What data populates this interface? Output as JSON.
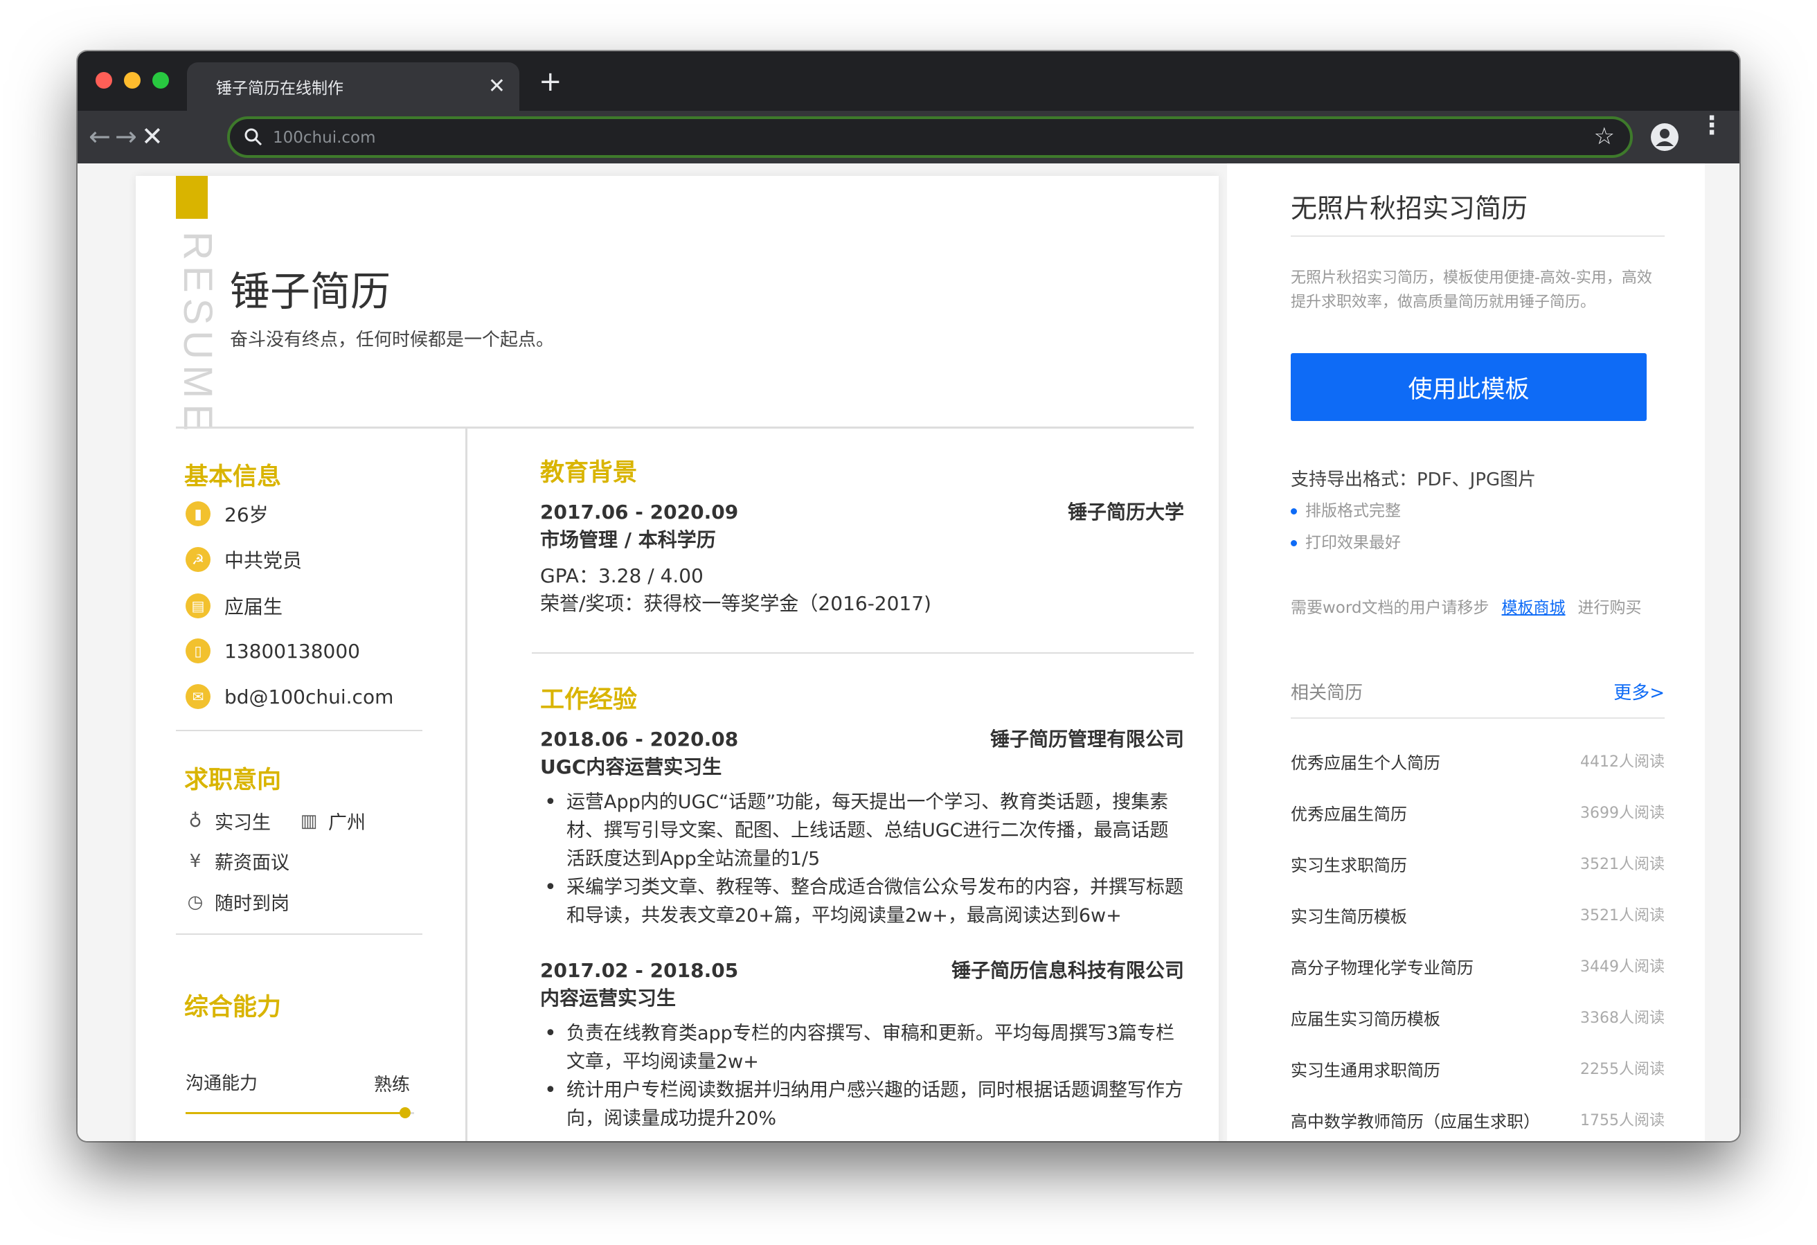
{
  "browser": {
    "tab_title": "锤子简历在线制作",
    "tab_close": "✕",
    "new_tab": "+",
    "url": "100chui.com",
    "colors": {
      "red": "#ff5f57",
      "yellow": "#febc2e",
      "green": "#28c840"
    }
  },
  "resume": {
    "vertical_label": "RESUME",
    "name": "锤子简历",
    "motto": "奋斗没有终点，任何时候都是一个起点。",
    "basic": {
      "title": "基本信息",
      "items": [
        {
          "icon": "chart-icon",
          "text": "26岁"
        },
        {
          "icon": "party-icon",
          "text": "中共党员"
        },
        {
          "icon": "calendar-icon",
          "text": "应届生"
        },
        {
          "icon": "phone-icon",
          "text": "13800138000"
        },
        {
          "icon": "mail-icon",
          "text": "bd@100chui.com"
        }
      ]
    },
    "intent": {
      "title": "求职意向",
      "job": "实习生",
      "city": "广州",
      "salary": "薪资面议",
      "start": "随时到岗"
    },
    "skills": {
      "title": "综合能力",
      "items": [
        {
          "name": "沟通能力",
          "level": "熟练",
          "fraction": 0.96
        }
      ]
    },
    "education": {
      "title": "教育背景",
      "period": "2017.06 - 2020.09",
      "school": "锤子简历大学",
      "major": "市场管理 / 本科学历",
      "gpa": "GPA：3.28 / 4.00",
      "honor": "荣誉/奖项：获得校一等奖学金（2016-2017)"
    },
    "work": {
      "title": "工作经验",
      "jobs": [
        {
          "period": "2018.06 - 2020.08",
          "company": "锤子简历管理有限公司",
          "role": "UGC内容运营实习生",
          "bullets": [
            "运营App内的UGC“话题”功能，每天提出一个学习、教育类话题，搜集素材、撰写引导文案、配图、上线话题、总结UGC进行二次传播，最高话题活跃度达到App全站流量的1/5",
            "采编学习类文章、教程等、整合成适合微信公众号发布的内容，并撰写标题和导读，共发表文章20+篇，平均阅读量2w+，最高阅读达到6w+"
          ]
        },
        {
          "period": "2017.02 - 2018.05",
          "company": "锤子简历信息科技有限公司",
          "role": "内容运营实习生",
          "bullets": [
            "负责在线教育类app专栏的内容撰写、审稿和更新。平均每周撰写3篇专栏文章，平均阅读量2w+",
            "统计用户专栏阅读数据并归纳用户感兴趣的话题，同时根据话题调整写作方向，阅读量成功提升20%"
          ]
        }
      ]
    }
  },
  "sidebar": {
    "title": "无照片秋招实习简历",
    "description": "无照片秋招实习简历，模板使用便捷-高效-实用，高效提升求职效率，做高质量简历就用锤子简历。",
    "use_button": "使用此模板",
    "formats": "支持导出格式：PDF、JPG图片",
    "features": [
      "排版格式完整",
      "打印效果最好"
    ],
    "word_prefix": "需要word文档的用户请移步",
    "word_link": "模板商城",
    "word_suffix": "进行购买",
    "related_title": "相关简历",
    "more": "更多>",
    "related": [
      {
        "name": "优秀应届生个人简历",
        "reads": "4412人阅读"
      },
      {
        "name": "优秀应届生简历",
        "reads": "3699人阅读"
      },
      {
        "name": "实习生求职简历",
        "reads": "3521人阅读"
      },
      {
        "name": "实习生简历模板",
        "reads": "3521人阅读"
      },
      {
        "name": "高分子物理化学专业简历",
        "reads": "3449人阅读"
      },
      {
        "name": "应届生实习简历模板",
        "reads": "3368人阅读"
      },
      {
        "name": "实习生通用求职简历",
        "reads": "2255人阅读"
      },
      {
        "name": "高中数学教师简历（应届生求职）",
        "reads": "1755人阅读"
      }
    ]
  }
}
